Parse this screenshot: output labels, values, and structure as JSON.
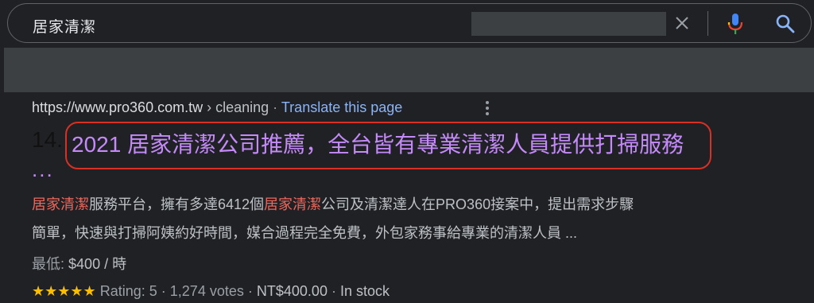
{
  "search": {
    "query": "居家清潔",
    "clear_icon": "close-icon",
    "mic_icon": "microphone-icon",
    "search_icon": "search-icon"
  },
  "result": {
    "url_host": "https://www.pro360.com.tw",
    "url_path": "› cleaning",
    "separator": "·",
    "translate": "Translate this page",
    "rank": "14.",
    "title": "2021 居家清潔公司推薦，全台皆有專業清潔人員提供打掃服務",
    "title_more": "...",
    "snippet_line1_a": "居家清潔",
    "snippet_line1_b": "服務平台，擁有多達6412個",
    "snippet_line1_c": "居家清潔",
    "snippet_line1_d": "公司及清潔達人在PRO360接案中，提出需求步驟",
    "snippet_line2": "簡單，快速與打掃阿姨約好時間，媒合過程完全免費，外包家務事給專業的清潔人員 ...",
    "price_label": "最低:",
    "price_value": "$400 / 時",
    "stars": "★★★★★",
    "rating": "Rating: 5",
    "votes": "1,274 votes",
    "price_ntd": "NT$400.00",
    "stock": "In stock"
  },
  "colors": {
    "background": "#202124",
    "visited_link": "#c58af9",
    "highlight": "#ee675c",
    "annotation_box": "#d93025",
    "star": "#fbbc04"
  }
}
